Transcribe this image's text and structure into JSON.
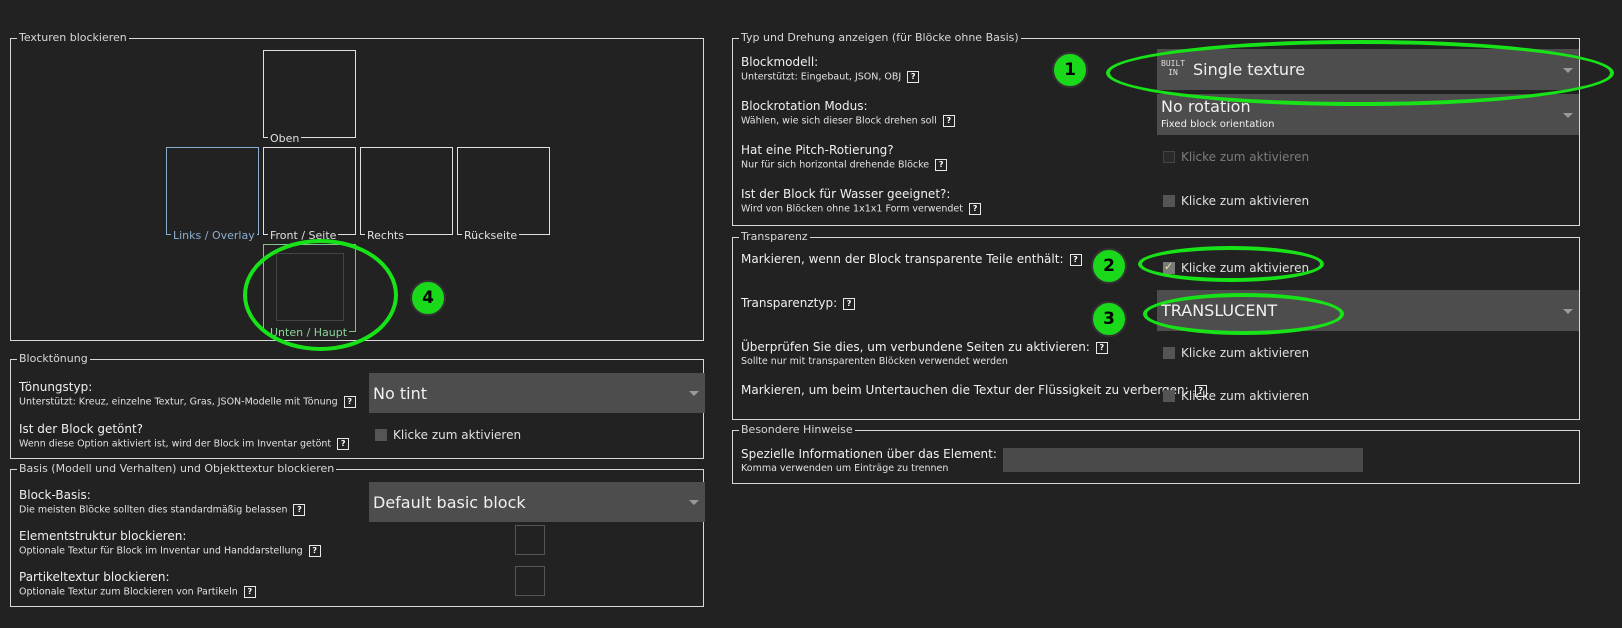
{
  "texture_panel": {
    "title": "Texturen blockieren",
    "top": "Oben",
    "left": "Links / Overlay",
    "front": "Front / Seite",
    "right": "Rechts",
    "back": "Rückseite",
    "bottom": "Unten / Haupt"
  },
  "tint_panel": {
    "title": "Blocktönung",
    "tint_type_label": "Tönungstyp:",
    "tint_type_sub": "Unterstützt: Kreuz, einzelne Textur, Gras, JSON-Modelle mit Tönung",
    "tint_type_value": "No tint",
    "is_tinted_label": "Ist der Block getönt?",
    "is_tinted_sub": "Wenn diese Option aktiviert ist, wird der Block im Inventar getönt",
    "is_tinted_check": "Klicke zum aktivieren"
  },
  "base_panel": {
    "title": "Basis (Modell und Verhalten) und Objekttextur blockieren",
    "base_label": "Block-Basis:",
    "base_sub": "Die meisten Blöcke sollten dies standardmäßig belassen",
    "base_value": "Default basic block",
    "item_label": "Elementstruktur blockieren:",
    "item_sub": "Optionale Textur für Block im Inventar und Handdarstellung",
    "particle_label": "Partikeltextur blockieren:",
    "particle_sub": "Optionale Textur zum Blockieren von Partikeln"
  },
  "type_panel": {
    "title": "Typ und Drehung anzeigen (für Blöcke ohne Basis)",
    "model_label": "Blockmodell:",
    "model_sub": "Unterstützt: Eingebaut, JSON, OBJ",
    "model_badge_top": "BUILT",
    "model_badge_bottom": "IN",
    "model_value": "Single texture",
    "rotation_label": "Blockrotation Modus:",
    "rotation_sub": "Wählen, wie sich dieser Block drehen soll",
    "rotation_value": "No rotation",
    "rotation_value_sub": "Fixed block orientation",
    "pitch_label": "Hat eine Pitch-Rotierung?",
    "pitch_sub": "Nur für sich horizontal drehende Blöcke",
    "pitch_check": "Klicke zum aktivieren",
    "water_label": "Ist der Block für Wasser geeignet?:",
    "water_sub": "Wird von Blöcken ohne 1x1x1 Form verwendet",
    "water_check": "Klicke zum aktivieren"
  },
  "transparency_panel": {
    "title": "Transparenz",
    "has_transparency_label": "Markieren, wenn der Block transparente Teile enthält:",
    "has_transparency_check": "Klicke zum aktivieren",
    "type_label": "Transparenztyp:",
    "type_value": "TRANSLUCENT",
    "connected_label": "Überprüfen Sie dies, um verbundene Seiten zu aktivieren:",
    "connected_sub": "Sollte nur mit transparenten Blöcken verwendet werden",
    "connected_check": "Klicke zum aktivieren",
    "fluid_label": "Markieren, um beim Untertauchen die Textur der Flüssigkeit zu verbergen:",
    "fluid_check": "Klicke zum aktivieren"
  },
  "notes_panel": {
    "title": "Besondere Hinweise",
    "info_label": "Spezielle Informationen über das Element:",
    "info_sub": "Komma verwenden um Einträge zu trennen",
    "info_value": ""
  },
  "help_glyph": "?",
  "annotations": [
    "1",
    "2",
    "3",
    "4"
  ],
  "colors": {
    "annotation": "#18e218",
    "background": "#222222",
    "field": "#4d4d4d"
  }
}
